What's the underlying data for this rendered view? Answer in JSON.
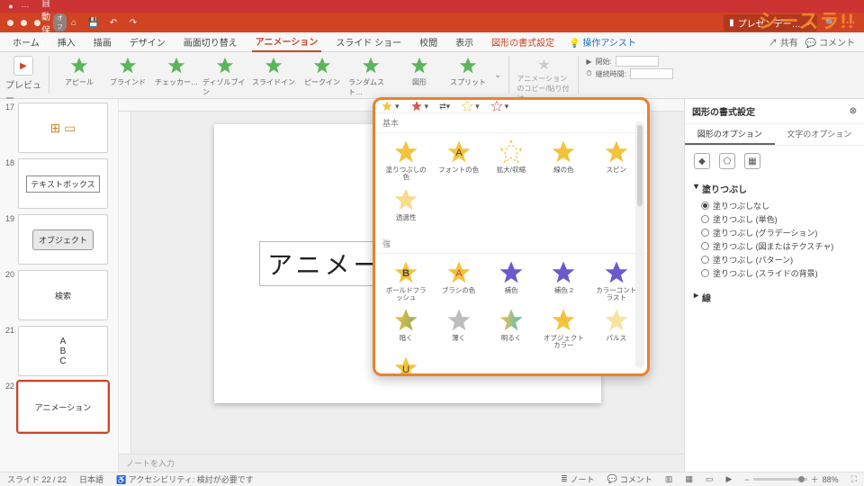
{
  "brand": "シースラ!!",
  "autosave": {
    "label": "自動保存",
    "state": "オフ"
  },
  "doc_title": "プレゼンテー…",
  "ribbon_tabs": {
    "home": "ホーム",
    "insert": "挿入",
    "draw": "描画",
    "design": "デザイン",
    "transition": "画面切り替え",
    "animation": "アニメーション",
    "slideshow": "スライド ショー",
    "review": "校閲",
    "view": "表示",
    "format": "図形の書式設定",
    "assist": "操作アシスト",
    "share": "共有",
    "comment": "コメント"
  },
  "ribbon": {
    "preview": "プレビュー",
    "items": [
      "アピール",
      "ブラインド",
      "チェッカー…",
      "ディゾルブイン",
      "スライドイン",
      "ピークイン",
      "ランダムスト…",
      "図形",
      "スプリット"
    ],
    "anim_copy": "アニメーションのコピー/貼り付け",
    "timing": {
      "start_label": "開始:",
      "duration_label": "継続時間:"
    }
  },
  "thumbs": [
    {
      "n": "17",
      "label": "",
      "icon": true
    },
    {
      "n": "18",
      "label": "テキストボックス"
    },
    {
      "n": "19",
      "label": "オブジェクト",
      "boxed": true
    },
    {
      "n": "20",
      "label": "検索"
    },
    {
      "n": "21",
      "label": "ABC",
      "vertical": true
    },
    {
      "n": "22",
      "label": "アニメーション",
      "selected": true
    }
  ],
  "slide_text": "アニメー",
  "notes_placeholder": "ノートを入力",
  "panel": {
    "top_buttons": [
      "",
      "",
      "",
      "",
      ""
    ],
    "section_basic": "基本",
    "basic": [
      "塗りつぶしの色",
      "フォントの色",
      "拡大/収縮",
      "線の色",
      "スピン",
      "透過性"
    ],
    "section_emph": "強",
    "emph": [
      "ボールドフラッシュ",
      "ブラシの色",
      "補色",
      "補色 2",
      "カラーコントラスト",
      "暗く",
      "薄く",
      "明るく",
      "オブジェクトカラー",
      "パルス",
      "U"
    ]
  },
  "format_pane": {
    "title": "図形の書式設定",
    "tab_shape": "図形のオプション",
    "tab_text": "文字のオプション",
    "group_fill": "塗りつぶし",
    "fill_options": [
      "塗りつぶしなし",
      "塗りつぶし (単色)",
      "塗りつぶし (グラデーション)",
      "塗りつぶし (図またはテクスチャ)",
      "塗りつぶし (パターン)",
      "塗りつぶし (スライドの背景)"
    ],
    "group_line": "線"
  },
  "status": {
    "slide": "スライド 22 / 22",
    "lang": "日本語",
    "a11y": "アクセシビリティ: 検討が必要です",
    "notes_btn": "ノート",
    "comment_btn": "コメント",
    "zoom": "88%"
  }
}
